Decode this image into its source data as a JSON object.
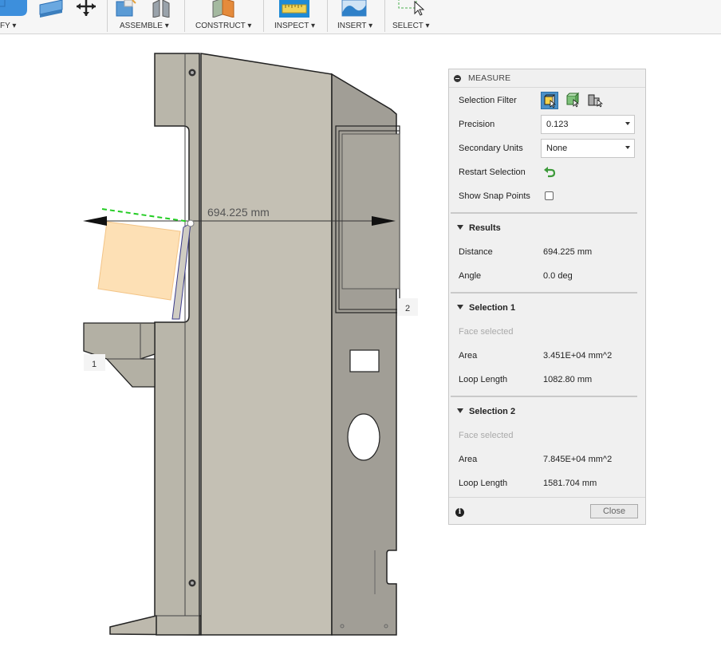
{
  "toolbar": {
    "groups": [
      {
        "label": "FY ▾"
      },
      {
        "label": "ASSEMBLE ▾"
      },
      {
        "label": "CONSTRUCT ▾"
      },
      {
        "label": "INSPECT ▾"
      },
      {
        "label": "INSERT ▾"
      },
      {
        "label": "SELECT ▾"
      }
    ]
  },
  "viewport": {
    "dimension_label": "694.225 mm",
    "marker_1": "1",
    "marker_2": "2"
  },
  "measure": {
    "title": "MEASURE",
    "selection_filter_label": "Selection Filter",
    "precision_label": "Precision",
    "precision_value": "0.123",
    "secondary_units_label": "Secondary Units",
    "secondary_units_value": "None",
    "restart_selection_label": "Restart Selection",
    "show_snap_points_label": "Show Snap Points",
    "show_snap_points_checked": false,
    "results": {
      "heading": "Results",
      "distance_label": "Distance",
      "distance_value": "694.225 mm",
      "angle_label": "Angle",
      "angle_value": "0.0 deg"
    },
    "selection1": {
      "heading": "Selection 1",
      "status": "Face selected",
      "area_label": "Area",
      "area_value": "3.451E+04 mm^2",
      "loop_label": "Loop Length",
      "loop_value": "1082.80 mm"
    },
    "selection2": {
      "heading": "Selection 2",
      "status": "Face selected",
      "area_label": "Area",
      "area_value": "7.845E+04 mm^2",
      "loop_label": "Loop Length",
      "loop_value": "1581.704 mm"
    },
    "close_label": "Close"
  },
  "colors": {
    "accent": "#4a90c8",
    "body_fill": "#c3c0b5",
    "highlight_face": "#fddba8",
    "dim_green": "#22cc22"
  }
}
